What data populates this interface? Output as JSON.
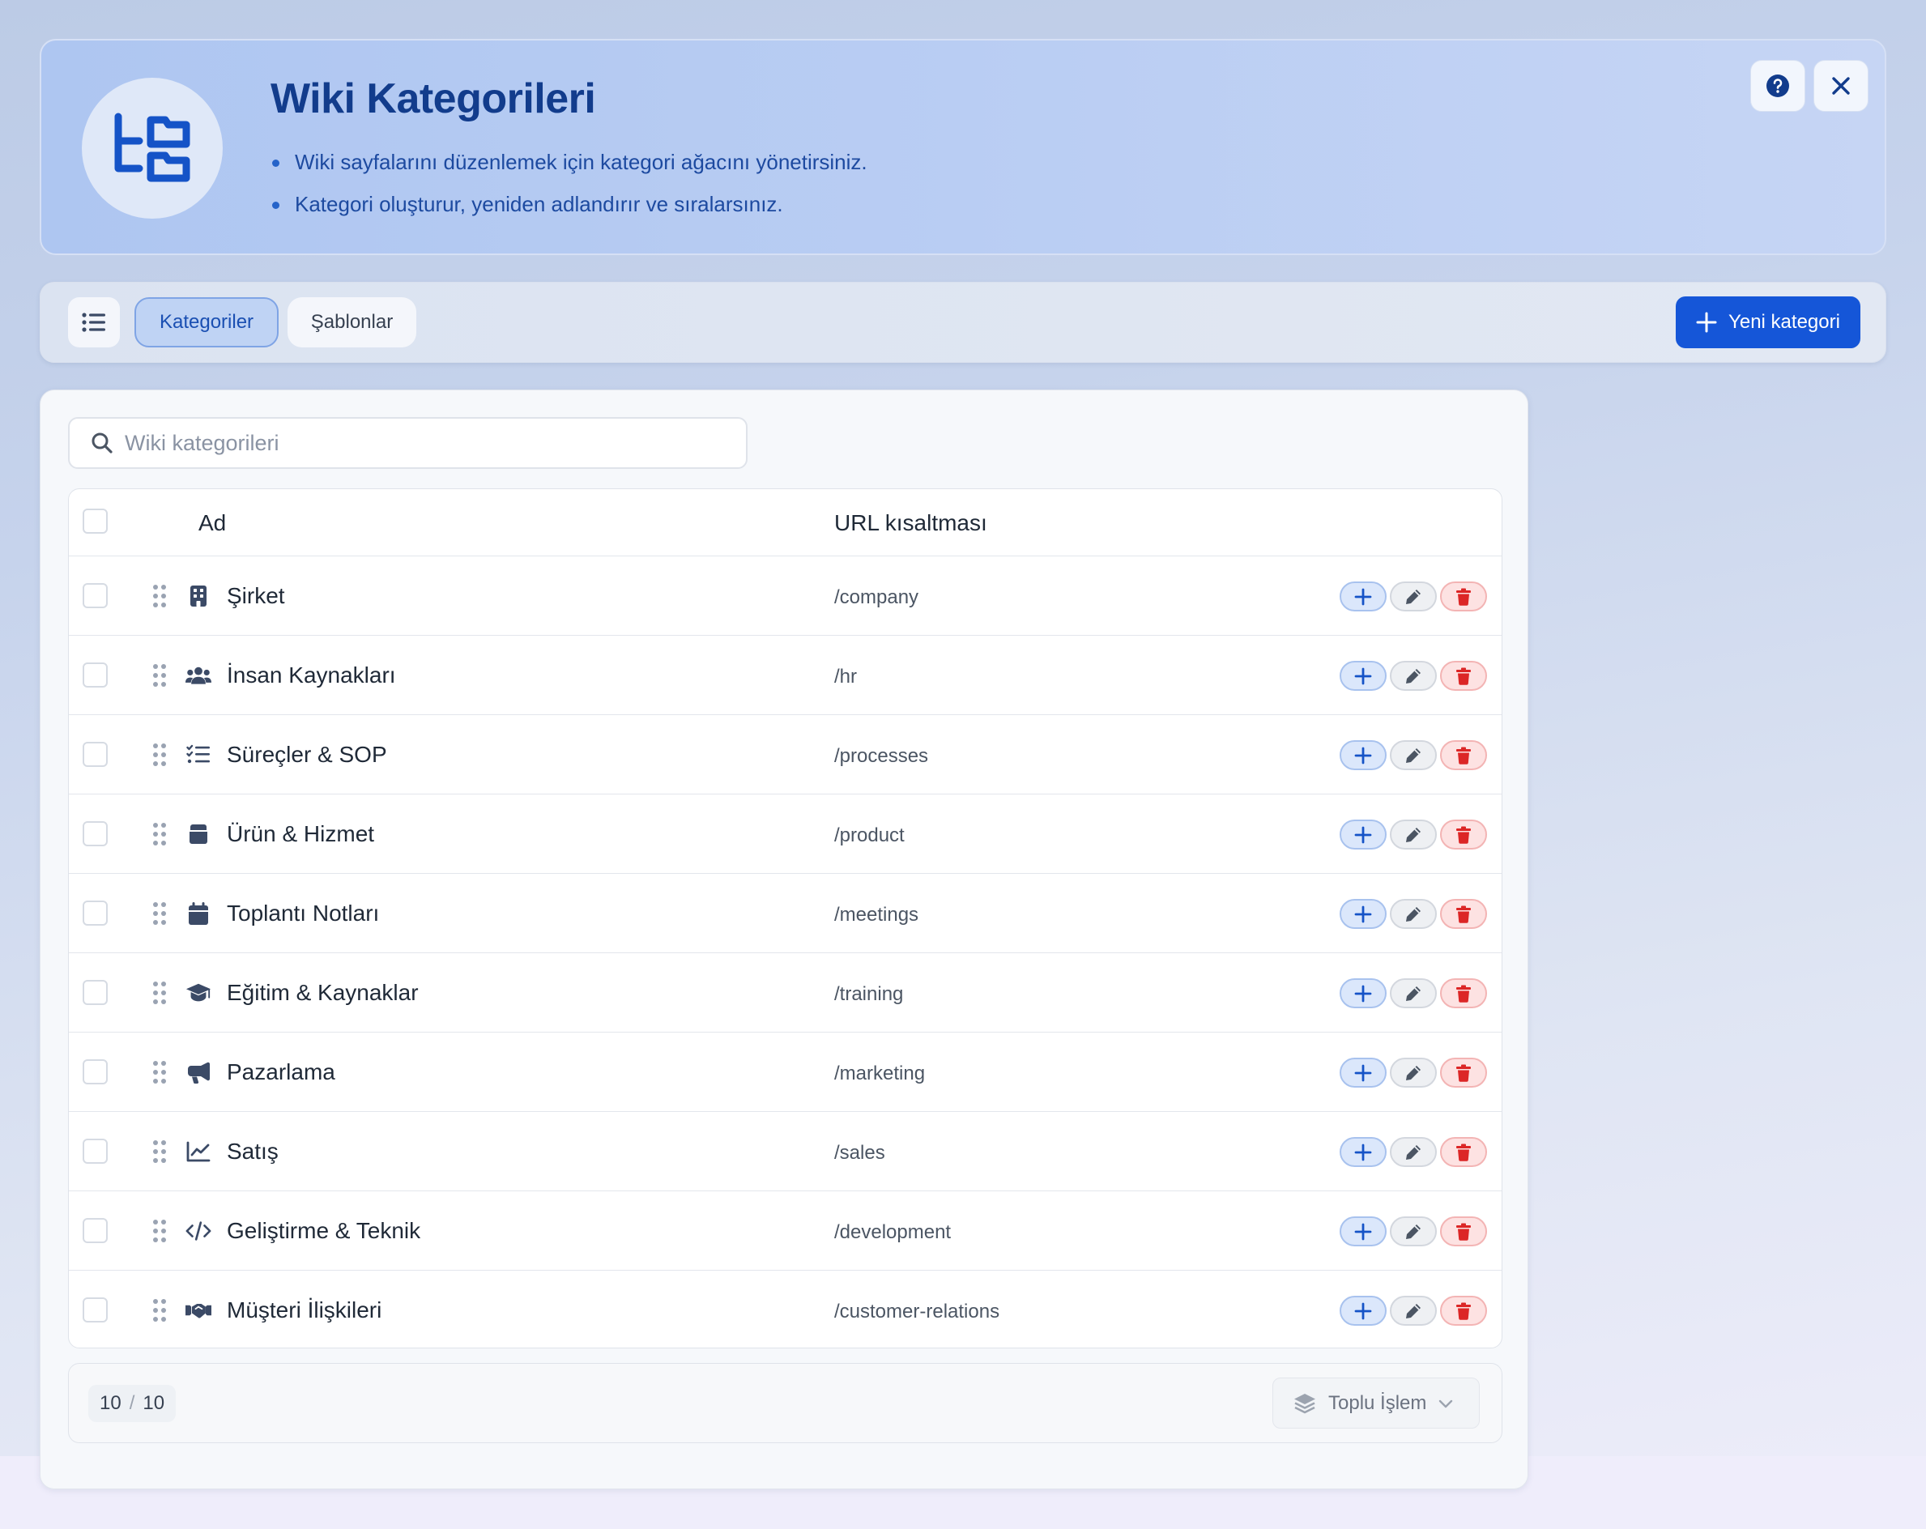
{
  "header": {
    "title": "Wiki Kategorileri",
    "bullets": [
      "Wiki sayfalarını düzenlemek için kategori ağacını yönetirsiniz.",
      "Kategori oluşturur, yeniden adlandırır ve sıralarsınız."
    ],
    "icon": "folder-tree-icon",
    "help_icon": "help-icon",
    "close_icon": "close-icon"
  },
  "toolbar": {
    "menu_icon": "list-icon",
    "tabs": [
      {
        "label": "Kategoriler",
        "active": true
      },
      {
        "label": "Şablonlar",
        "active": false
      }
    ],
    "new_button_label": "Yeni kategori"
  },
  "search": {
    "placeholder": "Wiki kategorileri"
  },
  "table": {
    "columns": {
      "name": "Ad",
      "url": "URL kısaltması"
    },
    "rows": [
      {
        "name": "Şirket",
        "url": "/company",
        "icon": "building-icon"
      },
      {
        "name": "İnsan Kaynakları",
        "url": "/hr",
        "icon": "users-icon"
      },
      {
        "name": "Süreçler & SOP",
        "url": "/processes",
        "icon": "checklist-icon"
      },
      {
        "name": "Ürün & Hizmet",
        "url": "/product",
        "icon": "box-icon"
      },
      {
        "name": "Toplantı Notları",
        "url": "/meetings",
        "icon": "calendar-icon"
      },
      {
        "name": "Eğitim & Kaynaklar",
        "url": "/training",
        "icon": "graduation-cap-icon"
      },
      {
        "name": "Pazarlama",
        "url": "/marketing",
        "icon": "megaphone-icon"
      },
      {
        "name": "Satış",
        "url": "/sales",
        "icon": "chart-line-icon"
      },
      {
        "name": "Geliştirme & Teknik",
        "url": "/development",
        "icon": "code-icon"
      },
      {
        "name": "Müşteri İlişkileri",
        "url": "/customer-relations",
        "icon": "handshake-icon"
      }
    ]
  },
  "footer": {
    "shown": "10",
    "total": "10",
    "separator": "/",
    "bulk_label": "Toplu İşlem"
  },
  "colors": {
    "primary": "#1556d8",
    "title": "#123c8c",
    "danger": "#dc2626"
  }
}
